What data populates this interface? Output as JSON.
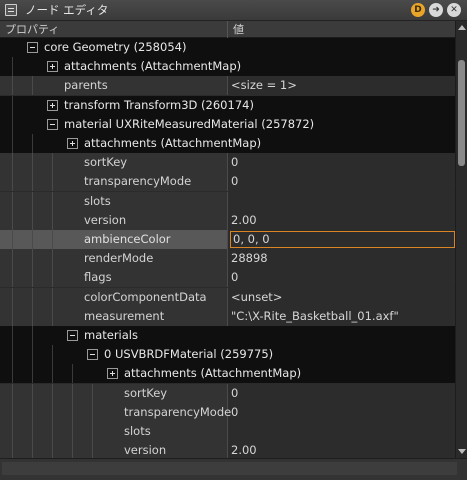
{
  "window": {
    "title": "ノード エディタ",
    "buttons": [
      "D",
      "➜",
      "✕"
    ]
  },
  "columns": {
    "property": "プロパティ",
    "value": "値"
  },
  "rows": [
    {
      "label": "core Geometry (258054)",
      "value": "",
      "kind": "group",
      "depth": 1,
      "toggle": "minus"
    },
    {
      "label": "attachments (AttachmentMap)",
      "value": "",
      "kind": "group",
      "depth": 2,
      "toggle": "plus"
    },
    {
      "label": "parents",
      "value": "<size = 1>",
      "kind": "prop",
      "depth": 2,
      "toggle": ""
    },
    {
      "label": "transform Transform3D (260174)",
      "value": "",
      "kind": "group",
      "depth": 2,
      "toggle": "plus"
    },
    {
      "label": "material UXRiteMeasuredMaterial (257872)",
      "value": "",
      "kind": "group",
      "depth": 2,
      "toggle": "minus"
    },
    {
      "label": "attachments (AttachmentMap)",
      "value": "",
      "kind": "group",
      "depth": 3,
      "toggle": "plus"
    },
    {
      "label": "sortKey",
      "value": "0",
      "kind": "prop",
      "depth": 3,
      "toggle": ""
    },
    {
      "label": "transparencyMode",
      "value": "0",
      "kind": "prop",
      "depth": 3,
      "toggle": ""
    },
    {
      "label": "slots",
      "value": "",
      "kind": "prop",
      "depth": 3,
      "toggle": ""
    },
    {
      "label": "version",
      "value": "2.00",
      "kind": "prop",
      "depth": 3,
      "toggle": ""
    },
    {
      "label": "ambienceColor",
      "value": "0, 0, 0",
      "kind": "sel",
      "depth": 3,
      "toggle": ""
    },
    {
      "label": "renderMode",
      "value": "28898",
      "kind": "prop",
      "depth": 3,
      "toggle": ""
    },
    {
      "label": "flags",
      "value": "0",
      "kind": "prop",
      "depth": 3,
      "toggle": ""
    },
    {
      "label": "colorComponentData",
      "value": "<unset>",
      "kind": "prop",
      "depth": 3,
      "toggle": ""
    },
    {
      "label": "measurement",
      "value": "\"C:\\X-Rite_Basketball_01.axf\"",
      "kind": "prop",
      "depth": 3,
      "toggle": ""
    },
    {
      "label": "materials",
      "value": "",
      "kind": "group",
      "depth": 3,
      "toggle": "minus"
    },
    {
      "label": "0 USVBRDFMaterial (259775)",
      "value": "",
      "kind": "group",
      "depth": 4,
      "toggle": "minus"
    },
    {
      "label": "attachments (AttachmentMap)",
      "value": "",
      "kind": "group",
      "depth": 5,
      "toggle": "plus"
    },
    {
      "label": "sortKey",
      "value": "0",
      "kind": "prop",
      "depth": 5,
      "toggle": ""
    },
    {
      "label": "transparencyMode",
      "value": "0",
      "kind": "prop",
      "depth": 5,
      "toggle": ""
    },
    {
      "label": "slots",
      "value": "",
      "kind": "prop",
      "depth": 5,
      "toggle": ""
    },
    {
      "label": "version",
      "value": "2.00",
      "kind": "prop",
      "depth": 5,
      "toggle": ""
    }
  ],
  "icons": {
    "window": "node-editor-icon",
    "expand": "plus-box-icon",
    "collapse": "minus-box-icon"
  }
}
